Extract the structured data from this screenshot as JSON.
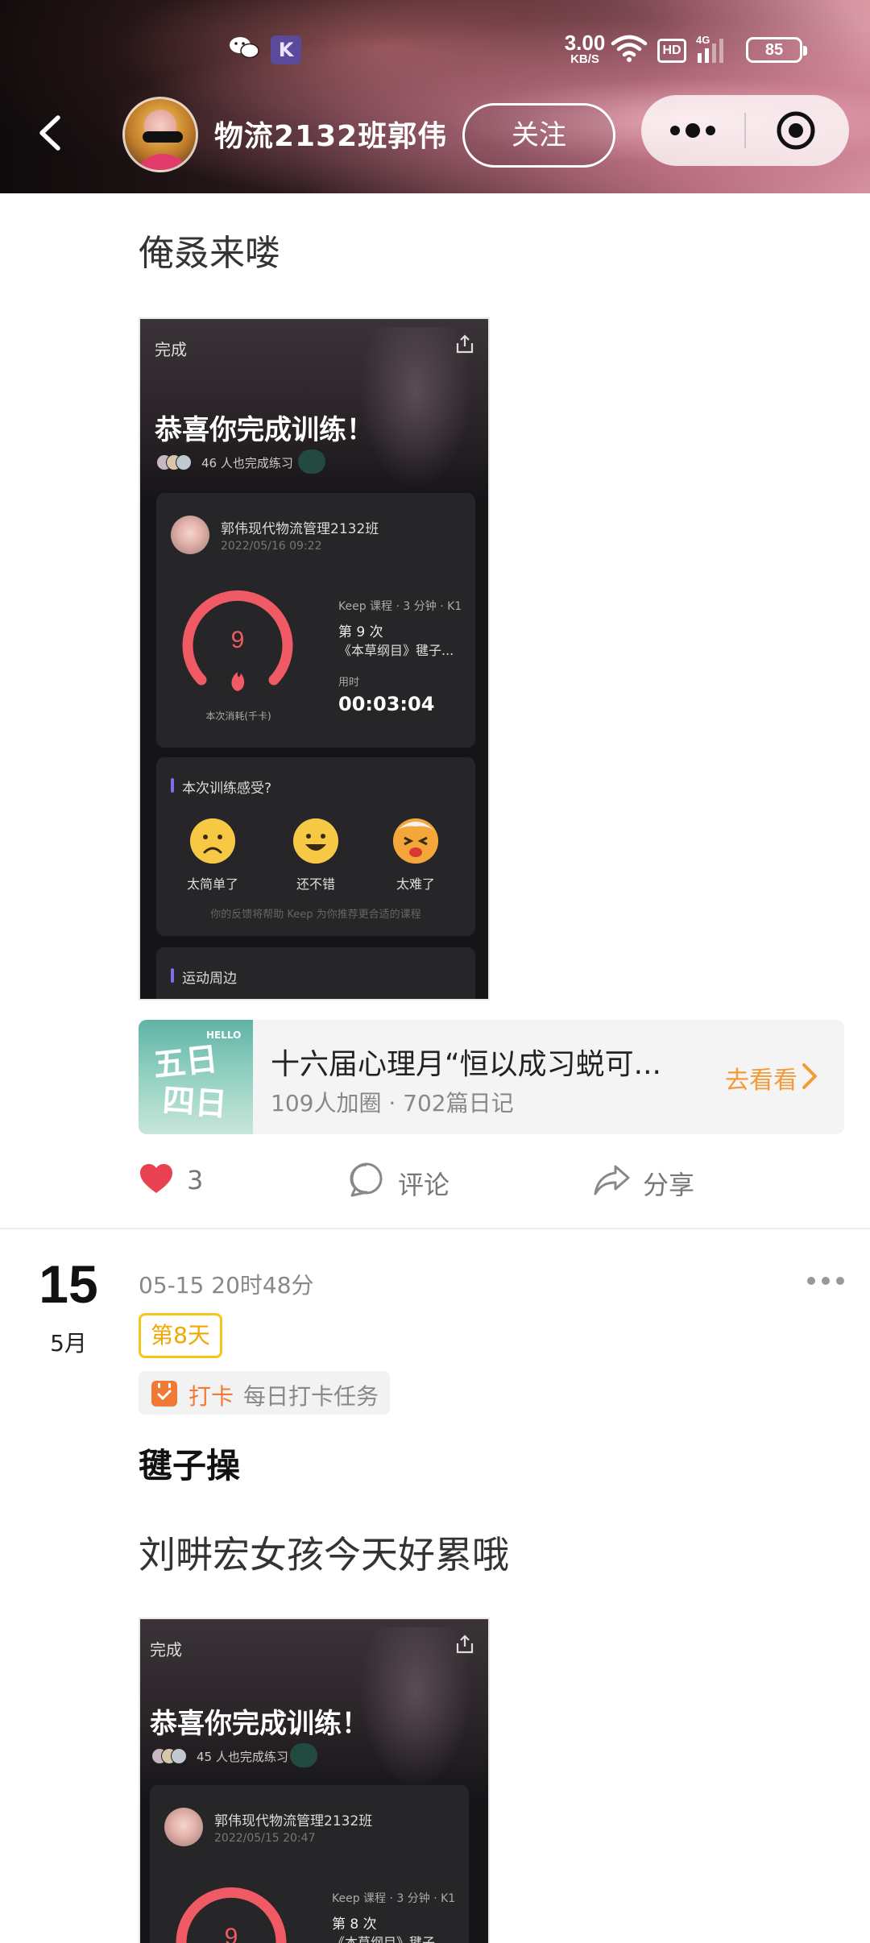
{
  "status_bar": {
    "speed_value": "3.00",
    "speed_unit": "KB/S",
    "hd": "HD",
    "network": "4G",
    "battery": "85",
    "k_app": "K"
  },
  "header": {
    "username": "物流2132班郭伟",
    "follow_label": "关注"
  },
  "post1": {
    "text": "俺叒来喽",
    "screenshot": {
      "done": "完成",
      "congrats": "恭喜你完成训练！",
      "participants": "46 人也完成练习",
      "user_name": "郭伟现代物流管理2132班",
      "date": "2022/05/16 09:22",
      "kcal_value": "9",
      "kcal_label": "本次消耗(千卡)",
      "course_meta": "Keep 课程 · 3 分钟 · K1",
      "count": "第 9 次",
      "course_title": "《本草纲目》毽子...",
      "used_label": "用时",
      "used_time": "00:03:04",
      "feedback_title": "本次训练感受?",
      "feedback_options": [
        "太简单了",
        "还不错",
        "太难了"
      ],
      "feedback_note": "你的反馈将帮助 Keep 为你推荐更合适的课程",
      "nearby": "运动周边"
    }
  },
  "topic": {
    "title": "十六届心理月“恒以成习蜕可...",
    "subtitle": "109人加圈 · 702篇日记",
    "go_label": "去看看"
  },
  "actions": {
    "likes": "3",
    "comment": "评论",
    "share": "分享"
  },
  "post2": {
    "day": "15",
    "month": "5月",
    "time": "05-15 20时48分",
    "badge": "第8天",
    "tag_label": "打卡",
    "tag_task": "每日打卡任务",
    "title": "毽子操",
    "text": "刘畊宏女孩今天好累哦",
    "screenshot": {
      "done": "完成",
      "congrats": "恭喜你完成训练！",
      "participants": "45 人也完成练习",
      "user_name": "郭伟现代物流管理2132班",
      "date": "2022/05/15 20:47",
      "kcal_value": "9",
      "course_meta": "Keep 课程 · 3 分钟 · K1",
      "count": "第 8 次",
      "course_title": "《本草纲目》毽子..."
    }
  },
  "colors": {
    "accent_orange": "#f29b38",
    "badge_yellow": "#f5c518",
    "like_red": "#e8414f",
    "ring_red": "#ef5a64"
  }
}
